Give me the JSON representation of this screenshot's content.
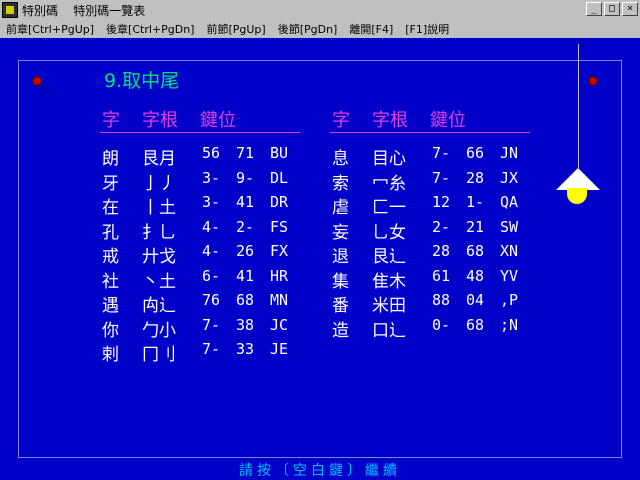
{
  "window": {
    "title": "特別碼    特別碼一覽表",
    "min_label": "_",
    "max_label": "□",
    "close_label": "×"
  },
  "menu": [
    "前章[Ctrl+PgUp]",
    "後章[Ctrl+PgDn]",
    "前節[PgUp]",
    "後節[PgDn]",
    "離開[F4]",
    "[F1]說明"
  ],
  "section_title": "9.取中尾",
  "columns": {
    "char": "字",
    "root": "字根",
    "keys": "鍵位"
  },
  "left_rows": [
    {
      "char": "朗",
      "root": "艮月",
      "p1": "56",
      "p2": "71",
      "key": "BU"
    },
    {
      "char": "牙",
      "root": "亅丿",
      "p1": "3-",
      "p2": "9-",
      "key": "DL"
    },
    {
      "char": "在",
      "root": "丨土",
      "p1": "3-",
      "p2": "41",
      "key": "DR"
    },
    {
      "char": "孔",
      "root": "扌乚",
      "p1": "4-",
      "p2": "2-",
      "key": "FS"
    },
    {
      "char": "戒",
      "root": "廾戈",
      "p1": "4-",
      "p2": "26",
      "key": "FX"
    },
    {
      "char": "社",
      "root": "丶土",
      "p1": "6-",
      "p2": "41",
      "key": "HR"
    },
    {
      "char": "遇",
      "root": "禸辶",
      "p1": "76",
      "p2": "68",
      "key": "MN"
    },
    {
      "char": "你",
      "root": "勹小",
      "p1": "7-",
      "p2": "38",
      "key": "JC"
    },
    {
      "char": "剌",
      "root": "冂刂",
      "p1": "7-",
      "p2": "33",
      "key": "JE"
    }
  ],
  "right_rows": [
    {
      "char": "息",
      "root": "目心",
      "p1": "7-",
      "p2": "66",
      "key": "JN"
    },
    {
      "char": "索",
      "root": "冖糸",
      "p1": "7-",
      "p2": "28",
      "key": "JX"
    },
    {
      "char": "虐",
      "root": "匚一",
      "p1": "12",
      "p2": "1-",
      "key": "QA"
    },
    {
      "char": "妄",
      "root": "乚女",
      "p1": "2-",
      "p2": "21",
      "key": "SW"
    },
    {
      "char": "退",
      "root": "艮辶",
      "p1": "28",
      "p2": "68",
      "key": "XN"
    },
    {
      "char": "集",
      "root": "隹木",
      "p1": "61",
      "p2": "48",
      "key": "YV"
    },
    {
      "char": "番",
      "root": "米田",
      "p1": "88",
      "p2": "04",
      "key": ",P"
    },
    {
      "char": "造",
      "root": "口辶",
      "p1": "0-",
      "p2": "68",
      "key": ";N"
    }
  ],
  "footer": "請按〔空白鍵〕繼續",
  "colors": {
    "background": "#0000c8",
    "heading": "#00e080",
    "column_header": "#e040e0",
    "text": "#ffffff",
    "footer": "#00c0ff"
  }
}
